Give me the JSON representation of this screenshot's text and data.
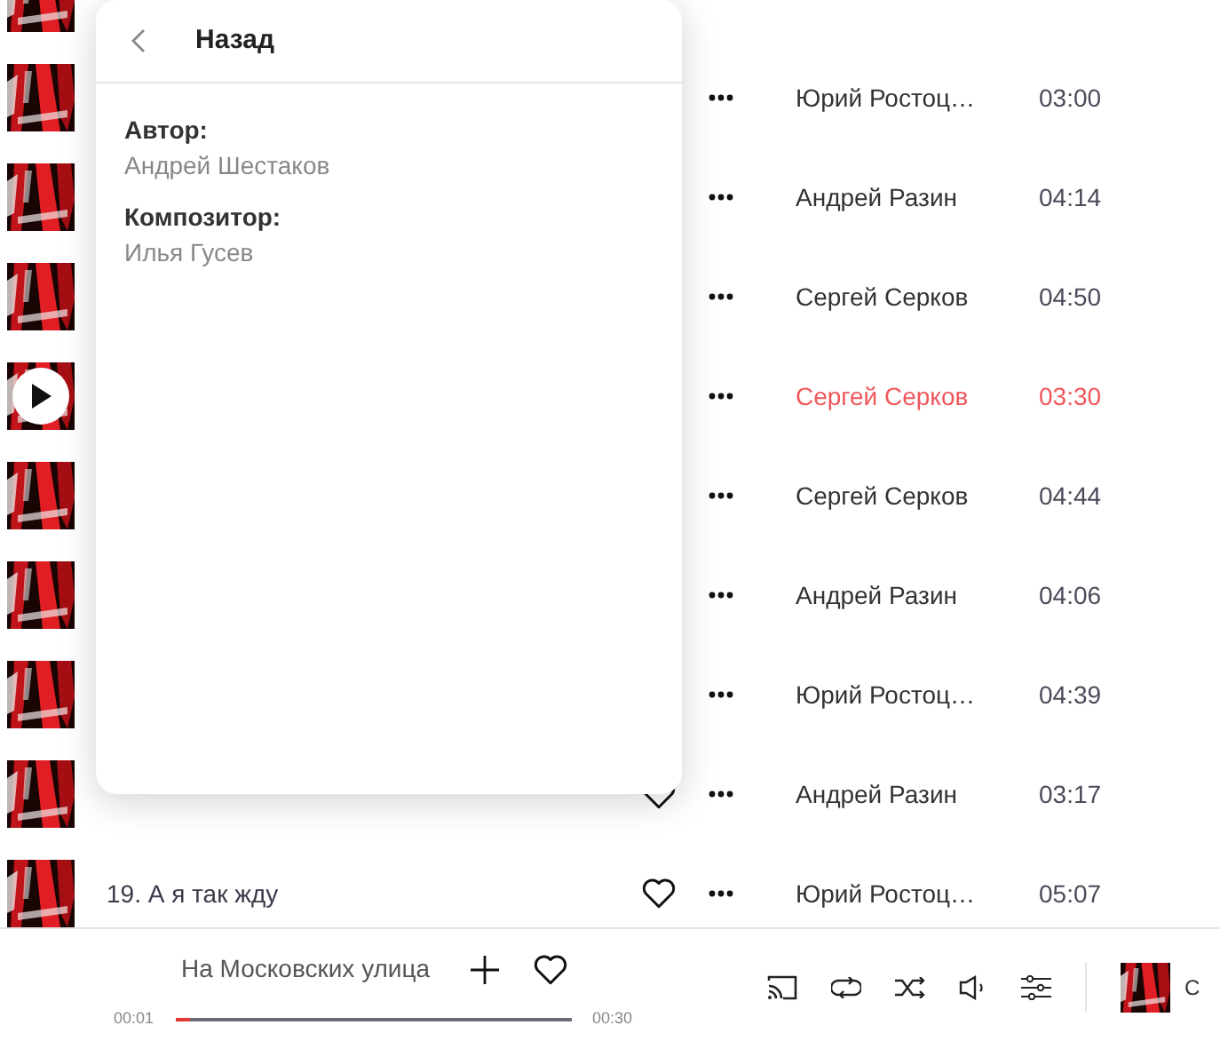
{
  "tracks": [
    {
      "artist": "Юрий Ростоц…",
      "duration": "03:00",
      "playing": false
    },
    {
      "artist": "Андрей Разин",
      "duration": "04:14",
      "playing": false
    },
    {
      "artist": "Сергей Серков",
      "duration": "04:50",
      "playing": false
    },
    {
      "artist": "Сергей Серков",
      "duration": "03:30",
      "playing": true
    },
    {
      "artist": "Сергей Серков",
      "duration": "04:44",
      "playing": false
    },
    {
      "artist": "Андрей Разин",
      "duration": "04:06",
      "playing": false
    },
    {
      "artist": "Юрий Ростоц…",
      "duration": "04:39",
      "playing": false
    },
    {
      "artist": "Андрей Разин",
      "duration": "03:17",
      "playing": false
    },
    {
      "title": "19. А я так жду",
      "artist": "Юрий Ростоц…",
      "duration": "05:07",
      "playing": false
    }
  ],
  "popup": {
    "back_label": "Назад",
    "credits": [
      {
        "role": "Автор:",
        "name": "Андрей Шестаков"
      },
      {
        "role": "Композитор:",
        "name": "Илья Гусев"
      }
    ]
  },
  "player": {
    "title": "На Московских улица",
    "elapsed": "00:01",
    "total": "00:30",
    "level": 0.04,
    "next_title": "С"
  }
}
